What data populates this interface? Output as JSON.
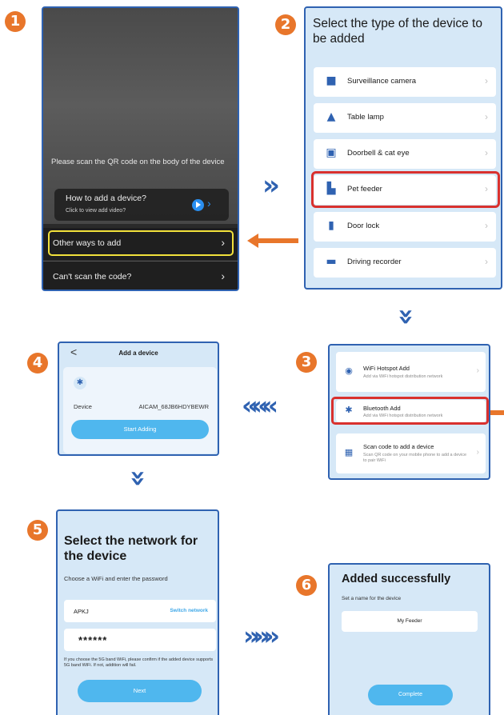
{
  "badges": [
    "1",
    "2",
    "3",
    "4",
    "5",
    "6"
  ],
  "colors": {
    "accent": "#2f62b1",
    "orange": "#e8762b",
    "highlight_red": "#d9312e",
    "highlight_yellow": "#f2e13b",
    "button_blue": "#4fb7ee",
    "panel_bg": "#d6e8f7"
  },
  "step1": {
    "scan_instruction": "Please scan the QR code on the body of the device",
    "howto_title": "How to add a device?",
    "howto_sub": "Click to view add video?",
    "other_ways": "Other ways to add",
    "cant_scan": "Can't scan the code?"
  },
  "step2": {
    "title": "Select the type of the device to be added",
    "items": [
      {
        "label": "Surveillance camera",
        "icon": "camera-icon"
      },
      {
        "label": "Table lamp",
        "icon": "lamp-icon"
      },
      {
        "label": "Doorbell & cat eye",
        "icon": "doorbell-icon"
      },
      {
        "label": "Pet feeder",
        "icon": "feeder-icon"
      },
      {
        "label": "Door lock",
        "icon": "lock-icon"
      },
      {
        "label": "Driving recorder",
        "icon": "car-icon"
      }
    ]
  },
  "step3": {
    "options": [
      {
        "title": "WiFi Hotspot Add",
        "sub": "Add via WiFi hotspot distribution network"
      },
      {
        "title": "Bluetooth Add",
        "sub": "Add via WiFi hotspot distribution network"
      },
      {
        "title": "Scan code to add a device",
        "sub": "Scan QR code on your mobile phone to add a device to pair WiFi"
      }
    ]
  },
  "step4": {
    "back": "<",
    "title": "Add a device",
    "device_label": "Device",
    "device_id": "AICAM_68JB6HDYBEWR",
    "button": "Start Adding"
  },
  "step5": {
    "title": "Select the network for the device",
    "subtitle": "Choose a WiFi and enter the password",
    "ssid": "APKJ",
    "switch_network": "Switch network",
    "password_mask": "******",
    "note": "If you choose the 5G band WiFi, please confirm if the added device supports 5G band WiFi. If not, addition will fail.",
    "button": "Next"
  },
  "step6": {
    "title": "Added successfully",
    "subtitle": "Set a name for the device",
    "name": "My Feeder",
    "button": "Complete"
  },
  "flow_arrows": {
    "right1": "»",
    "down1": "»",
    "left1": "«««",
    "down2": "»",
    "right2": "»»»"
  }
}
